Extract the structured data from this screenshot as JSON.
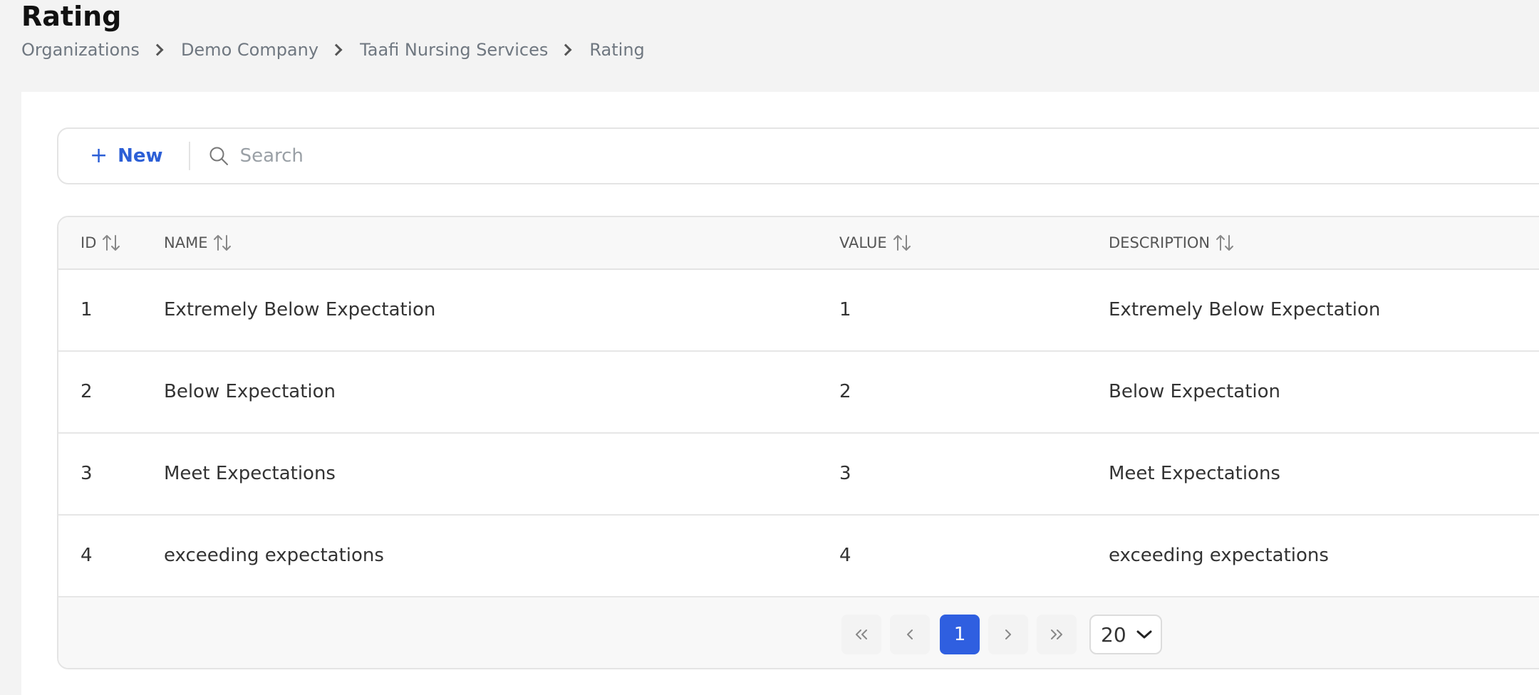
{
  "header": {
    "title": "Rating",
    "breadcrumb": [
      "Organizations",
      "Demo Company",
      "Taafi Nursing Services",
      "Rating"
    ]
  },
  "toolbar": {
    "new_label": "New",
    "search_placeholder": "Search"
  },
  "table": {
    "columns": [
      "ID",
      "NAME",
      "VALUE",
      "DESCRIPTION"
    ],
    "rows": [
      {
        "id": "1",
        "name": "Extremely Below Expectation",
        "value": "1",
        "description": "Extremely Below Expectation"
      },
      {
        "id": "2",
        "name": "Below Expectation",
        "value": "2",
        "description": "Below Expectation"
      },
      {
        "id": "3",
        "name": "Meet Expectations",
        "value": "3",
        "description": "Meet Expectations"
      },
      {
        "id": "4",
        "name": "exceeding expectations",
        "value": "4",
        "description": "exceeding expectations"
      }
    ]
  },
  "pagination": {
    "first_icon": "double-chevron-left-icon",
    "prev_icon": "chevron-left-icon",
    "current_page": "1",
    "next_icon": "chevron-right-icon",
    "last_icon": "double-chevron-right-icon",
    "page_size": "20"
  },
  "colors": {
    "accent": "#2f5fe0",
    "link": "#2c5fd6"
  }
}
